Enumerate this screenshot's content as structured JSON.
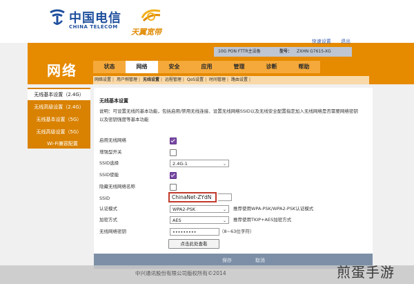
{
  "header": {
    "brand_cn": "中国电信",
    "brand_en": "CHINA TELECOM",
    "sub_brand": "天翼宽带",
    "top_links": [
      "快速设置",
      "退出"
    ]
  },
  "device": {
    "type": "10G PON FTTR主设备",
    "model_label": "型号：",
    "model_value": "ZXHN G7615-XG"
  },
  "section_title": "网络",
  "tabs": [
    {
      "label": "状态",
      "active": false
    },
    {
      "label": "网络",
      "active": true
    },
    {
      "label": "安全",
      "active": false
    },
    {
      "label": "应用",
      "active": false
    },
    {
      "label": "管理",
      "active": false
    },
    {
      "label": "诊断",
      "active": false
    },
    {
      "label": "帮助",
      "active": false
    }
  ],
  "subtabs": [
    {
      "label": "网络设置",
      "active": false
    },
    {
      "label": "用户侧管理",
      "active": false
    },
    {
      "label": "无线设置",
      "active": true
    },
    {
      "label": "远程管理",
      "active": false
    },
    {
      "label": "QoS设置",
      "active": false
    },
    {
      "label": "时间管理",
      "active": false
    },
    {
      "label": "路由设置",
      "active": false
    }
  ],
  "sidebar": [
    {
      "label": "无线基本设置（2.4G）",
      "active": true
    },
    {
      "label": "无线高级设置（2.4G）",
      "active": false
    },
    {
      "label": "无线基本设置（5G）",
      "active": false
    },
    {
      "label": "无线高级设置（5G）",
      "active": false
    },
    {
      "label": "Wi-Fi兼容配置",
      "active": false
    }
  ],
  "main": {
    "title": "无线基本设置",
    "description": "说明：可设置无线的基本功能，包括启用/禁用无线连接、设置无线网络SSID以及无线安全配置指定加入无线网络是否需要网络密钥以及密钥强度等基本功能",
    "fields": {
      "enable_wireless": {
        "label": "启用无线网络",
        "checked": true
      },
      "enhanced_switch": {
        "label": "增强型开关",
        "checked": false
      },
      "ssid_select": {
        "label": "SSID选择",
        "value": "2.4G-1"
      },
      "ssid_enable": {
        "label": "SSID使能",
        "checked": true
      },
      "hide_ssid": {
        "label": "隐藏无线网络名称",
        "checked": false
      },
      "ssid": {
        "label": "SSID",
        "value": "ChinaNet-ZYdN"
      },
      "auth_mode": {
        "label": "认证模式",
        "value": "WPA2-PSK",
        "hint": "推荐使用WPA-PSK/WPA2-PSK认证模式"
      },
      "encryption": {
        "label": "加密方式",
        "value": "AES",
        "hint": "推荐使用TKIP+AES加密方式"
      },
      "password": {
        "label": "无线网络密钥",
        "value": "•••••••••",
        "hint": "（8~63位字符）"
      }
    },
    "apply_label": "点击此处查看"
  },
  "bottom": {
    "save_label": "保存",
    "cancel_label": "取消"
  },
  "footer": {
    "copyright": "中兴通讯股份有限公司版权所有©2014"
  },
  "watermark": "煎蛋手游",
  "colors": {
    "orange": "#e68a00",
    "telecom_blue": "#1e4f9d",
    "highlight_red": "#c0392b",
    "checkbox_purple": "#7a4ba6"
  }
}
